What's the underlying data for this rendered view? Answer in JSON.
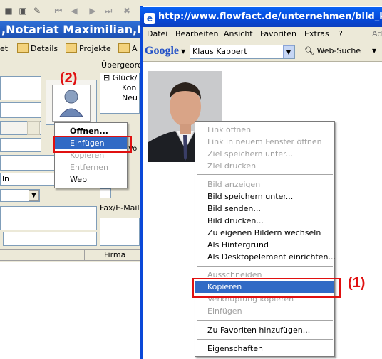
{
  "background_app": {
    "title": ",Notariat Maximilian,Ko",
    "tabs": [
      "et",
      "Details",
      "Projekte",
      "A"
    ],
    "tree_header": "Übergeord",
    "tree_items": [
      "Glück/",
      "Kon",
      "Neu"
    ],
    "field_texts": [
      "ln"
    ],
    "fax_label": "Fax/E-Mail",
    "table_header": "Firma",
    "vo_label": "Vo"
  },
  "popup_menu_left": {
    "items": [
      {
        "label": "Öffnen...",
        "state": "bold"
      },
      {
        "label": "Einfügen",
        "state": "selected"
      },
      {
        "label": "Kopieren",
        "state": "disabled"
      },
      {
        "label": "Entfernen",
        "state": "disabled"
      },
      {
        "label": "Web",
        "state": "normal"
      }
    ]
  },
  "ie_window": {
    "title": "http://www.flowfact.de/unternehmen/bild_kk.jpg - ",
    "menu": [
      "Datei",
      "Bearbeiten",
      "Ansicht",
      "Favoriten",
      "Extras",
      "?"
    ],
    "address_partial": "Ad",
    "google_logo": "Google",
    "search_value": "Klaus Kappert",
    "web_search_label": "Web-Suche"
  },
  "context_menu_right": {
    "items": [
      {
        "label": "Link öffnen",
        "state": "disabled"
      },
      {
        "label": "Link in neuem Fenster öffnen",
        "state": "disabled"
      },
      {
        "label": "Ziel speichern unter...",
        "state": "disabled"
      },
      {
        "label": "Ziel drucken",
        "state": "disabled"
      },
      {
        "label": "Bild anzeigen",
        "state": "disabled"
      },
      {
        "label": "Bild speichern unter...",
        "state": "normal"
      },
      {
        "label": "Bild senden...",
        "state": "normal"
      },
      {
        "label": "Bild drucken...",
        "state": "normal"
      },
      {
        "label": "Zu eigenen Bildern wechseln",
        "state": "normal"
      },
      {
        "label": "Als Hintergrund",
        "state": "normal"
      },
      {
        "label": "Als Desktopelement einrichten...",
        "state": "normal"
      },
      {
        "label": "Ausschneiden",
        "state": "disabled"
      },
      {
        "label": "Kopieren",
        "state": "selected"
      },
      {
        "label": "Verknüpfung kopieren",
        "state": "disabled"
      },
      {
        "label": "Einfügen",
        "state": "disabled"
      },
      {
        "label": "Zu Favoriten hinzufügen...",
        "state": "normal"
      },
      {
        "label": "Eigenschaften",
        "state": "normal"
      }
    ]
  },
  "annotations": {
    "callout_1": "(1)",
    "callout_2": "(2)"
  },
  "colors": {
    "annotation_red": "#e01010",
    "selection_blue": "#316ac5",
    "xp_title_blue": "#0548d8"
  }
}
